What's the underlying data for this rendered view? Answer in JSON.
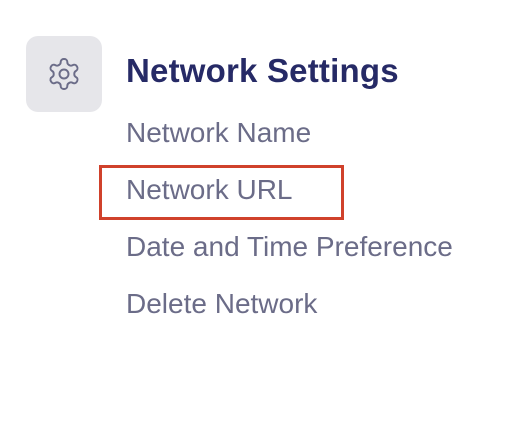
{
  "settings_icon": {
    "icon": "gear-icon",
    "tile_color": "#e6e6ea",
    "stroke_color": "#6b6c88"
  },
  "section": {
    "title": "Network Settings",
    "title_color": "#262a66"
  },
  "menu": {
    "item_color": "#6b6c88",
    "items": [
      {
        "label": "Network Name"
      },
      {
        "label": "Network URL",
        "highlighted": true
      },
      {
        "label": "Date and Time Preference"
      },
      {
        "label": "Delete Network"
      }
    ]
  },
  "highlight": {
    "color": "#d0412b"
  }
}
